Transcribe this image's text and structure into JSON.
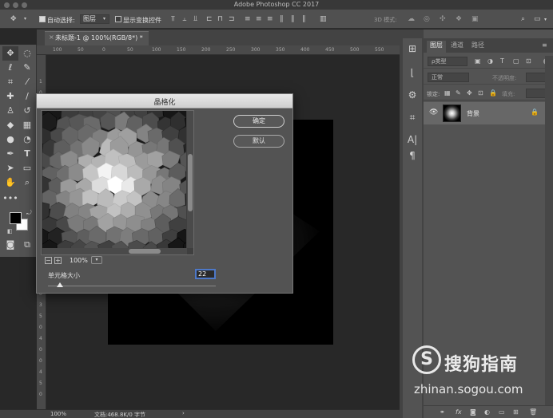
{
  "app": {
    "title": "Adobe Photoshop CC 2017"
  },
  "options_bar": {
    "auto_select_label": "自动选择:",
    "auto_select_value": "图层",
    "show_transform_label": "显示变换控件",
    "mode_3d_label": "3D 模式:"
  },
  "document_tab": {
    "close_glyph": "×",
    "label": "未标题-1 @ 100%(RGB/8*) *"
  },
  "ruler": {
    "top_ticks": [
      "100",
      "50",
      "0",
      "50",
      "100",
      "150",
      "200",
      "250",
      "300",
      "350",
      "400",
      "450",
      "500",
      "550"
    ],
    "left_ticks": [
      "1",
      "0",
      "0",
      "5",
      "0",
      "1",
      "0",
      "0",
      "1",
      "5",
      "0",
      "2",
      "0",
      "0",
      "2",
      "5",
      "0",
      "3",
      "0",
      "0",
      "3",
      "5",
      "0",
      "4",
      "0",
      "0",
      "4",
      "5",
      "0"
    ]
  },
  "status_bar": {
    "zoom": "100%",
    "doc_info": "文档:468.8K/0 字节"
  },
  "dialog": {
    "title": "晶格化",
    "ok_label": "确定",
    "default_label": "默认",
    "zoom_out_glyph": "−",
    "zoom_in_glyph": "+",
    "zoom_value": "100%",
    "zoom_dropdown_glyph": "▾",
    "cell_size_label": "单元格大小",
    "cell_size_value": "22",
    "cell_size_fraction": 0.07
  },
  "layers_panel": {
    "tabs": [
      "图层",
      "通道",
      "路径"
    ],
    "active_tab": 0,
    "filter_kind": "ρ类型",
    "blend_mode": "正常",
    "opacity_label": "不透明度:",
    "lock_label": "锁定:",
    "fill_label": "填充:",
    "layer_name": "背景",
    "footer_fx": "fx"
  },
  "watermark": {
    "logo_glyph": "S",
    "name": "搜狗指南",
    "url": "zhinan.sogou.com"
  },
  "colors": {
    "accent_focus": "#4d78c8",
    "panel_bg": "#535353",
    "workspace_bg": "#282828"
  },
  "icons": {
    "toolbar": [
      "move-icon",
      "marquee-icon",
      "lasso-icon",
      "quick-select-icon",
      "crop-icon",
      "eyedropper-icon",
      "healing-icon",
      "brush-icon",
      "stamp-icon",
      "history-brush-icon",
      "eraser-icon",
      "gradient-icon",
      "blur-icon",
      "dodge-icon",
      "pen-icon",
      "type-icon",
      "path-select-icon",
      "rectangle-icon",
      "hand-icon",
      "zoom-icon"
    ]
  }
}
